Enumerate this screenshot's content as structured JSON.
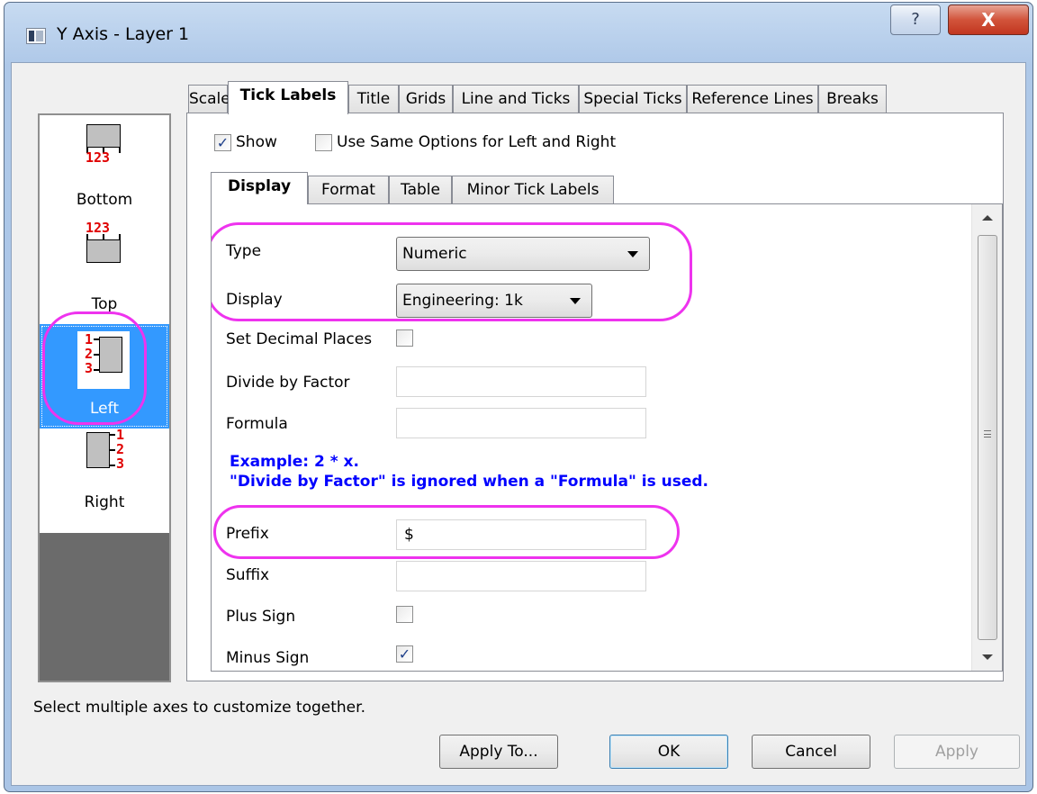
{
  "window": {
    "title": "Y Axis - Layer 1",
    "help_symbol": "?",
    "close_symbol": "X"
  },
  "axis_list": {
    "items": [
      {
        "label": "Bottom",
        "icon_numbers": "123"
      },
      {
        "label": "Top",
        "icon_numbers": "123"
      },
      {
        "label": "Left",
        "icon_numbers": [
          "1",
          "2",
          "3"
        ],
        "selected": true
      },
      {
        "label": "Right",
        "icon_numbers": [
          "1",
          "2",
          "3"
        ]
      }
    ]
  },
  "tabs": [
    "Scale",
    "Tick Labels",
    "Title",
    "Grids",
    "Line and Ticks",
    "Special Ticks",
    "Reference Lines",
    "Breaks"
  ],
  "active_tab": "Tick Labels",
  "tick_labels": {
    "show_label": "Show",
    "show_checked": true,
    "same_options_label": "Use Same Options for Left and Right",
    "same_options_checked": false,
    "subtabs": [
      "Display",
      "Format",
      "Table",
      "Minor Tick Labels"
    ],
    "active_subtab": "Display",
    "display": {
      "type_label": "Type",
      "type_value": "Numeric",
      "display_label": "Display",
      "display_value": "Engineering: 1k",
      "decimal_label": "Set Decimal Places",
      "decimal_checked": false,
      "factor_label": "Divide by Factor",
      "factor_value": "",
      "formula_label": "Formula",
      "formula_value": "",
      "example_line1": "Example: 2 * x.",
      "example_line2": "\"Divide by Factor\" is ignored when a \"Formula\" is used.",
      "prefix_label": "Prefix",
      "prefix_value": "$",
      "suffix_label": "Suffix",
      "suffix_value": "",
      "plus_label": "Plus Sign",
      "plus_checked": false,
      "minus_label": "Minus Sign",
      "minus_checked": true
    }
  },
  "status_text": "Select multiple axes to customize together.",
  "buttons": {
    "apply_to": "Apply To...",
    "ok": "OK",
    "cancel": "Cancel",
    "apply": "Apply"
  },
  "colors": {
    "highlight_ring": "#ee33ee",
    "selection_blue": "#3399ff",
    "example_text": "#0000ff",
    "icon_numbers": "#e00000"
  }
}
